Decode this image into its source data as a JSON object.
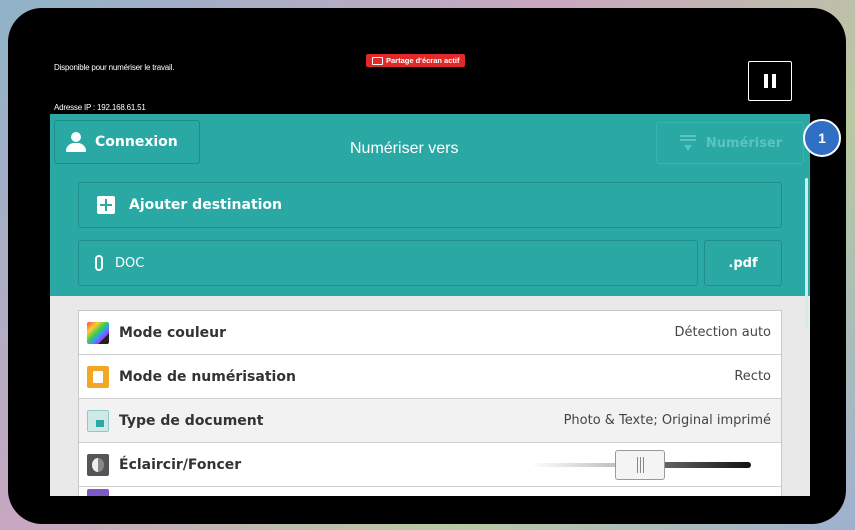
{
  "status": {
    "message": "Disponible pour numériser le travail.",
    "ip": "Adresse IP : 192.168.61.51",
    "share_badge": "Partage d'écran actif"
  },
  "header": {
    "login_label": "Connexion",
    "title": "Numériser vers",
    "scan_label": "Numériser"
  },
  "destination": {
    "add_label": "Ajouter destination",
    "file_name": "DOC",
    "file_ext": ".pdf"
  },
  "settings": [
    {
      "label": "Mode couleur",
      "value": "Détection auto",
      "icon": "color-mode-icon"
    },
    {
      "label": "Mode de numérisation",
      "value": "Recto",
      "icon": "scan-mode-icon"
    },
    {
      "label": "Type de document",
      "value": "Photo & Texte; Original imprimé",
      "icon": "document-type-icon"
    },
    {
      "label": "Éclaircir/Foncer",
      "value": "",
      "icon": "lighten-darken-icon"
    }
  ],
  "callout_badge": "1",
  "colors": {
    "teal": "#2aa8a4",
    "badge_blue": "#2f6fc4",
    "share_red": "#e02a2a"
  }
}
